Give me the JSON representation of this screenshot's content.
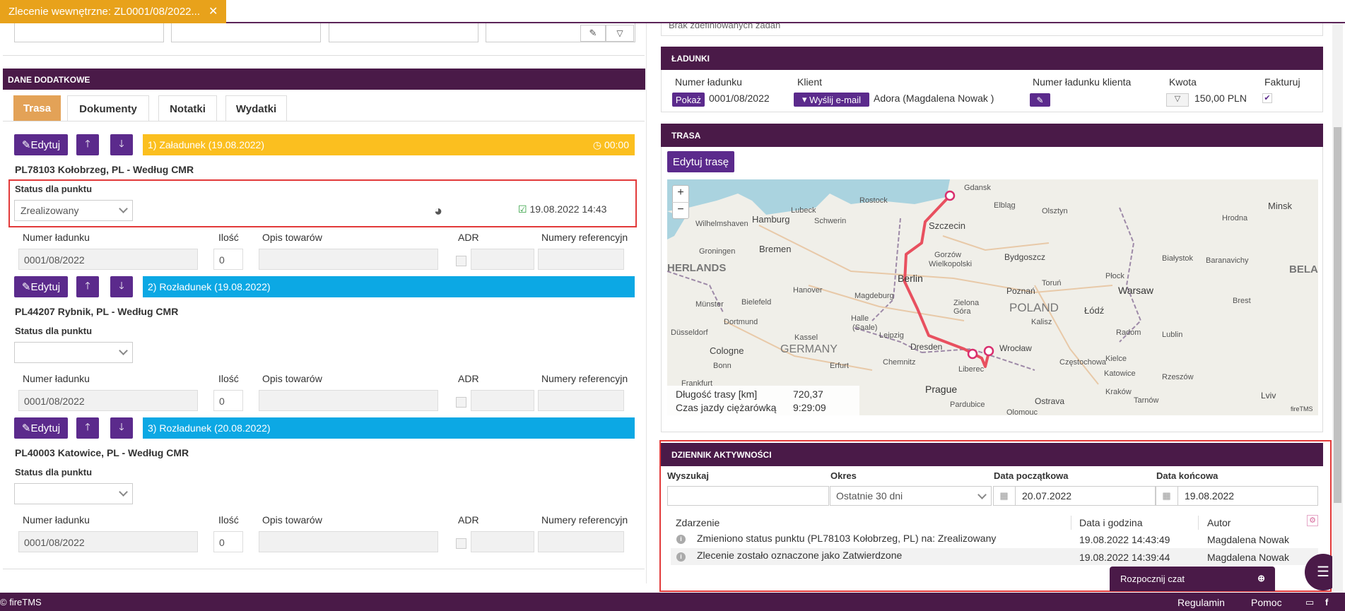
{
  "tab": {
    "title": "Zlecenie wewnętrzne: ZL0001/08/2022...",
    "close": "✕"
  },
  "left": {
    "section_title": "DANE DODATKOWE",
    "subtabs": [
      "Trasa",
      "Dokumenty",
      "Notatki",
      "Wydatki"
    ],
    "edit_label": "Edytuj",
    "status_label": "Status dla punktu",
    "load_headers": [
      "Numer ładunku",
      "Ilość",
      "Opis towarów",
      "ADR",
      "Numery referencyjn"
    ],
    "stops": [
      {
        "title": "1) Załadunek (19.08.2022)",
        "time": "00:00",
        "address": "PL78103 Kołobrzeg, PL - Według CMR",
        "status": "Zrealizowany",
        "done_at": "19.08.2022 14:43",
        "load_no": "0001/08/2022",
        "qty": "0",
        "color": "#fbbf1f"
      },
      {
        "title": "2) Rozładunek (19.08.2022)",
        "address": "PL44207 Rybnik, PL - Według CMR",
        "status": "",
        "load_no": "0001/08/2022",
        "qty": "0",
        "color": "#0ca8e4"
      },
      {
        "title": "3) Rozładunek (20.08.2022)",
        "address": "PL40003 Katowice, PL - Według CMR",
        "status": "",
        "load_no": "0001/08/2022",
        "qty": "0",
        "color": "#0ca8e4"
      }
    ]
  },
  "right": {
    "top_text": "Brak zdefiniowanych zadań",
    "ladunki": {
      "title": "ŁADUNKI",
      "headers": [
        "Numer ładunku",
        "Klient",
        "Numer ładunku klienta",
        "Kwota",
        "Fakturuj"
      ],
      "show_btn": "Pokaż",
      "load_no": "0001/08/2022",
      "email_btn": "Wyślij e-mail",
      "client": "Adora (Magdalena Nowak )",
      "amount": "150,00 PLN"
    },
    "trasa": {
      "title": "TRASA",
      "edit_btn": "Edytuj trasę",
      "length_label": "Długość trasy [km]",
      "length_value": "720,37",
      "time_label": "Czas jazdy ciężarówką",
      "time_value": "9:29:09",
      "credit": "fireTMS",
      "cities": [
        "Gdansk",
        "Elbląg",
        "Olsztyn",
        "Minsk",
        "Rostock",
        "Lubeck",
        "Hamburg",
        "Schwerin",
        "Szczecin",
        "Bydgoszcz",
        "Białystok",
        "Hrodna",
        "Baranavichy",
        "BELAR",
        "Wilhelmshaven",
        "Groningen",
        "Bremen",
        "Gorzów Wielkopolski",
        "Berlin",
        "Toruń",
        "Płock",
        "Warsaw",
        "HERLANDS",
        "Hanover",
        "Magdeburg",
        "Poznań",
        "POLAND",
        "Łódź",
        "Brest",
        "Bielefeld",
        "Münster",
        "Halle (Saale)",
        "Zielona Góra",
        "Kalisz",
        "Dortmund",
        "Leipzig",
        "Lublin",
        "Düsseldorf",
        "Kassel",
        "Wrocław",
        "Radom",
        "GERMANY",
        "Cologne",
        "Dresden",
        "Kielce",
        "Bonn",
        "Erfurt",
        "Chemnitz",
        "Częstochowa",
        "Frankfurt",
        "Liberec",
        "Katowice",
        "Rzeszów",
        "Kraków",
        "Tarnów",
        "Prague",
        "Ostrava",
        "Lviv",
        "Pardubice",
        "Olomouc"
      ],
      "zoom_in": "+",
      "zoom_out": "−"
    },
    "dziennik": {
      "title": "DZIENNIK AKTYWNOŚCI",
      "filters": {
        "search": "Wyszukaj",
        "period": "Okres",
        "start": "Data początkowa",
        "end": "Data końcowa"
      },
      "period_value": "Ostatnie 30 dni",
      "start_value": "20.07.2022",
      "end_value": "19.08.2022",
      "headers": [
        "Zdarzenie",
        "Data i godzina",
        "Autor"
      ],
      "rows": [
        {
          "event": "Zmieniono status punktu (PL78103 Kołobrzeg, PL) na: Zrealizowany",
          "date": "19.08.2022 14:43:49",
          "author": "Magdalena Nowak"
        },
        {
          "event": "Zlecenie zostało oznaczone jako Zatwierdzone",
          "date": "19.08.2022 14:39:44",
          "author": "Magdalena Nowak"
        }
      ]
    },
    "chat": "Rozpocznij czat"
  },
  "footer": {
    "brand": "© fireTMS",
    "links": [
      "Regulamin",
      "Pomoc"
    ]
  }
}
